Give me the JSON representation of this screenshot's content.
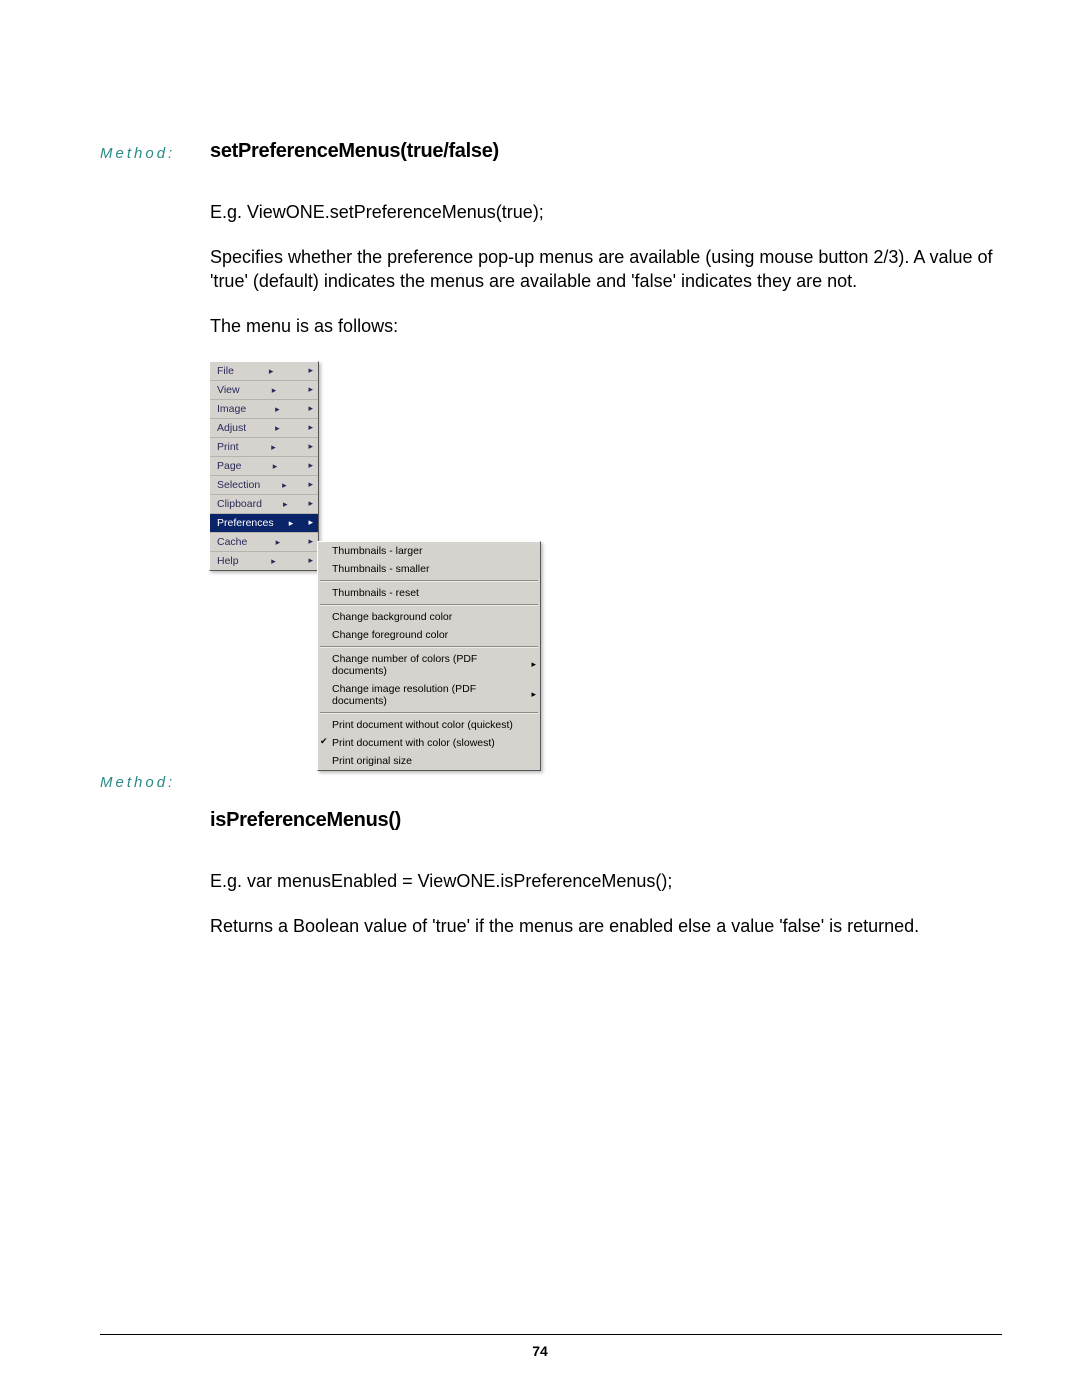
{
  "labels": {
    "method": "Method:"
  },
  "section1": {
    "heading": "setPreferenceMenus(true/false)",
    "eg": "E.g. ViewONE.setPreferenceMenus(true);",
    "desc": "Specifies whether the preference pop-up menus are available (using mouse button 2/3). A value of  'true' (default) indicates the menus are available and 'false' indicates they are not.",
    "menu_intro": "The menu is as follows:"
  },
  "menu": {
    "main": [
      "File",
      "View",
      "Image",
      "Adjust",
      "Print",
      "Page",
      "Selection",
      "Clipboard",
      "Preferences",
      "Cache",
      "Help"
    ],
    "selected_index": 8,
    "sub": [
      {
        "t": "Thumbnails - larger"
      },
      {
        "t": "Thumbnails - smaller"
      },
      {
        "div": true
      },
      {
        "t": "Thumbnails - reset"
      },
      {
        "div": true
      },
      {
        "t": "Change background color"
      },
      {
        "t": "Change foreground color"
      },
      {
        "div": true
      },
      {
        "t": "Change number of colors (PDF documents)",
        "arrow": true
      },
      {
        "t": "Change image resolution (PDF documents)",
        "arrow": true
      },
      {
        "div": true
      },
      {
        "t": "Print document without color (quickest)"
      },
      {
        "t": "Print document with color (slowest)",
        "check": true
      },
      {
        "t": "Print original size"
      }
    ]
  },
  "section2": {
    "heading": "isPreferenceMenus()",
    "eg": "E.g. var menusEnabled = ViewONE.isPreferenceMenus();",
    "desc": "Returns a Boolean value of 'true' if the menus are enabled else a value 'false' is returned."
  },
  "page_number": "74"
}
